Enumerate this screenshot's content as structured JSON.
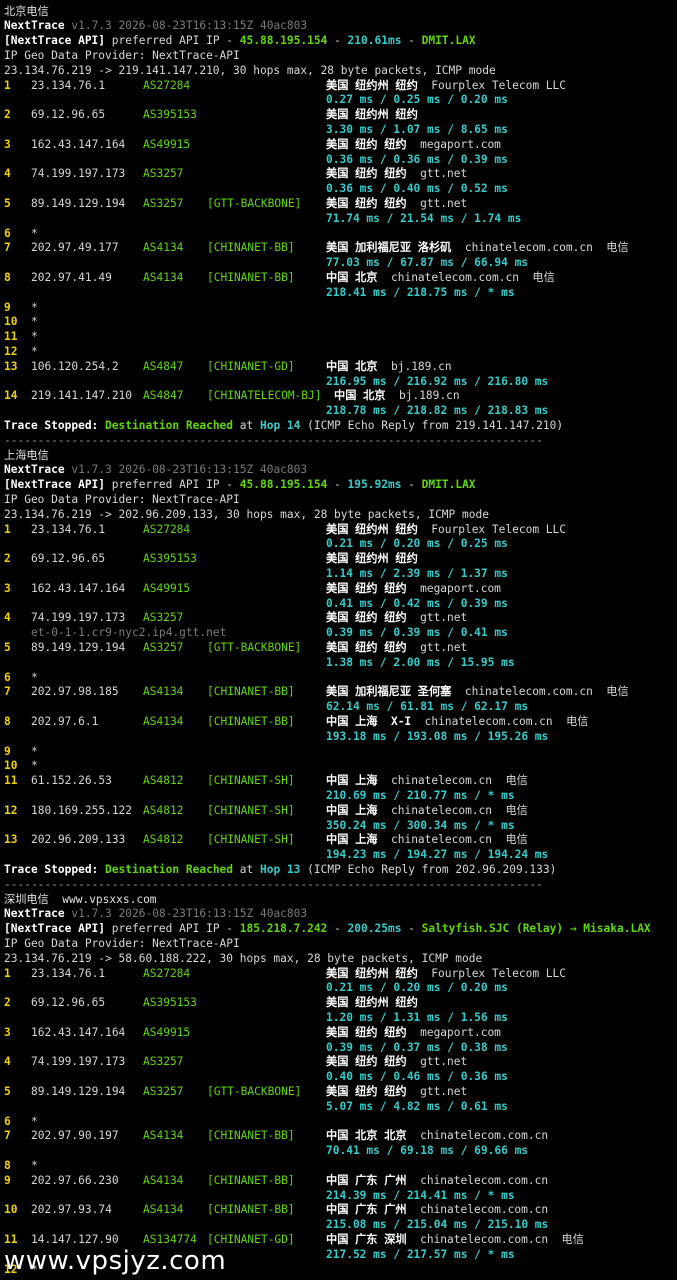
{
  "sections": [
    {
      "title": "北京电信",
      "watermark": "",
      "version_line": "v1.7.3 2026-08-23T16:13:15Z 40ac803",
      "api_ip": "45.88.195.154",
      "api_rtt": "210.61ms",
      "api_node": "DMIT.LAX",
      "provider": "IP Geo Data Provider: NextTrace-API",
      "route_line": "23.134.76.219 -> 219.141.147.210, 30 hops max, 28 byte packets, ICMP mode",
      "hops": [
        {
          "n": "1",
          "ip": "23.134.76.1",
          "as": "AS27284",
          "tag": "",
          "geo": "美国 纽约州 纽约",
          "org": "Fourplex Telecom LLC",
          "rtt": "0.27 ms / 0.25 ms / 0.20 ms"
        },
        {
          "n": "2",
          "ip": "69.12.96.65",
          "as": "AS395153",
          "tag": "",
          "geo": "美国 纽约州 纽约",
          "org": "",
          "rtt": "3.30 ms / 1.07 ms / 8.65 ms"
        },
        {
          "n": "3",
          "ip": "162.43.147.164",
          "as": "AS49915",
          "tag": "",
          "geo": "美国 纽约 纽约",
          "org": "megaport.com",
          "rtt": "0.36 ms / 0.36 ms / 0.39 ms"
        },
        {
          "n": "4",
          "ip": "74.199.197.173",
          "as": "AS3257",
          "tag": "",
          "geo": "美国 纽约 纽约",
          "org": "gtt.net",
          "rtt": "0.36 ms / 0.40 ms / 0.52 ms"
        },
        {
          "n": "5",
          "ip": "89.149.129.194",
          "as": "AS3257",
          "tag": "[GTT-BACKBONE]",
          "geo": "美国 纽约 纽约",
          "org": "gtt.net",
          "rtt": "71.74 ms / 21.54 ms / 1.74 ms"
        },
        {
          "n": "6",
          "ip": "*",
          "as": "",
          "tag": "",
          "geo": "",
          "org": "",
          "rtt": ""
        },
        {
          "n": "7",
          "ip": "202.97.49.177",
          "as": "AS4134",
          "tag": "[CHINANET-BB]",
          "geo": "美国 加利福尼亚 洛杉矶",
          "org": "chinatelecom.com.cn  电信",
          "rtt": "77.03 ms / 67.87 ms / 66.94 ms"
        },
        {
          "n": "8",
          "ip": "202.97.41.49",
          "as": "AS4134",
          "tag": "[CHINANET-BB]",
          "geo": "中国 北京",
          "org": "chinatelecom.com.cn  电信",
          "rtt": "218.41 ms / 218.75 ms / * ms"
        },
        {
          "n": "9",
          "ip": "*",
          "as": "",
          "tag": "",
          "geo": "",
          "org": "",
          "rtt": ""
        },
        {
          "n": "10",
          "ip": "*",
          "as": "",
          "tag": "",
          "geo": "",
          "org": "",
          "rtt": ""
        },
        {
          "n": "11",
          "ip": "*",
          "as": "",
          "tag": "",
          "geo": "",
          "org": "",
          "rtt": ""
        },
        {
          "n": "12",
          "ip": "*",
          "as": "",
          "tag": "",
          "geo": "",
          "org": "",
          "rtt": ""
        },
        {
          "n": "13",
          "ip": "106.120.254.2",
          "as": "AS4847",
          "tag": "[CHINANET-GD]",
          "geo": "中国 北京",
          "org": "bj.189.cn",
          "rtt": "216.95 ms / 216.92 ms / 216.80 ms"
        },
        {
          "n": "14",
          "ip": "219.141.147.210",
          "as": "AS4847",
          "tag": "[CHINATELECOM-BJ]",
          "geo": "中国 北京",
          "org": "bj.189.cn",
          "rtt": "218.78 ms / 218.82 ms / 218.83 ms"
        }
      ],
      "stop": {
        "hop": "Hop 14",
        "tail": "(ICMP Echo Reply from 219.141.147.210)"
      }
    },
    {
      "title": "上海电信",
      "watermark": "",
      "version_line": "v1.7.3 2026-08-23T16:13:15Z 40ac803",
      "api_ip": "45.88.195.154",
      "api_rtt": "195.92ms",
      "api_node": "DMIT.LAX",
      "provider": "IP Geo Data Provider: NextTrace-API",
      "route_line": "23.134.76.219 -> 202.96.209.133, 30 hops max, 28 byte packets, ICMP mode",
      "hops": [
        {
          "n": "1",
          "ip": "23.134.76.1",
          "as": "AS27284",
          "tag": "",
          "geo": "美国 纽约州 纽约",
          "org": "Fourplex Telecom LLC",
          "rtt": "0.21 ms / 0.20 ms / 0.25 ms"
        },
        {
          "n": "2",
          "ip": "69.12.96.65",
          "as": "AS395153",
          "tag": "",
          "geo": "美国 纽约州 纽约",
          "org": "",
          "rtt": "1.14 ms / 2.39 ms / 1.37 ms"
        },
        {
          "n": "3",
          "ip": "162.43.147.164",
          "as": "AS49915",
          "tag": "",
          "geo": "美国 纽约 纽约",
          "org": "megaport.com",
          "rtt": "0.41 ms / 0.42 ms / 0.39 ms"
        },
        {
          "n": "4",
          "ip": "74.199.197.173",
          "as": "AS3257",
          "tag": "",
          "geo": "美国 纽约 纽约",
          "org": "gtt.net",
          "rtt": "0.39 ms / 0.39 ms / 0.41 ms",
          "rdns": "et-0-1-1.cr9-nyc2.ip4.gtt.net"
        },
        {
          "n": "5",
          "ip": "89.149.129.194",
          "as": "AS3257",
          "tag": "[GTT-BACKBONE]",
          "geo": "美国 纽约 纽约",
          "org": "gtt.net",
          "rtt": "1.38 ms / 2.00 ms / 15.95 ms"
        },
        {
          "n": "6",
          "ip": "*",
          "as": "",
          "tag": "",
          "geo": "",
          "org": "",
          "rtt": ""
        },
        {
          "n": "7",
          "ip": "202.97.98.185",
          "as": "AS4134",
          "tag": "[CHINANET-BB]",
          "geo": "美国 加利福尼亚 圣何塞",
          "org": "chinatelecom.com.cn  电信",
          "rtt": "62.14 ms / 61.81 ms / 62.17 ms"
        },
        {
          "n": "8",
          "ip": "202.97.6.1",
          "as": "AS4134",
          "tag": "[CHINANET-BB]",
          "geo": "中国 上海  X-I",
          "org": "chinatelecom.com.cn  电信",
          "rtt": "193.18 ms / 193.08 ms / 195.26 ms"
        },
        {
          "n": "9",
          "ip": "*",
          "as": "",
          "tag": "",
          "geo": "",
          "org": "",
          "rtt": ""
        },
        {
          "n": "10",
          "ip": "*",
          "as": "",
          "tag": "",
          "geo": "",
          "org": "",
          "rtt": ""
        },
        {
          "n": "11",
          "ip": "61.152.26.53",
          "as": "AS4812",
          "tag": "[CHINANET-SH]",
          "geo": "中国 上海",
          "org": "chinatelecom.cn  电信",
          "rtt": "210.69 ms / 210.77 ms / * ms"
        },
        {
          "n": "12",
          "ip": "180.169.255.122",
          "as": "AS4812",
          "tag": "[CHINANET-SH]",
          "geo": "中国 上海",
          "org": "chinatelecom.cn  电信",
          "rtt": "350.24 ms / 300.34 ms / * ms"
        },
        {
          "n": "13",
          "ip": "202.96.209.133",
          "as": "AS4812",
          "tag": "[CHINANET-SH]",
          "geo": "中国 上海",
          "org": "chinatelecom.cn  电信",
          "rtt": "194.23 ms / 194.27 ms / 194.24 ms"
        }
      ],
      "stop": {
        "hop": "Hop 13",
        "tail": "(ICMP Echo Reply from 202.96.209.133)"
      }
    },
    {
      "title": "深圳电信",
      "watermark": "www.vpsxxs.com",
      "version_line": "v1.7.3 2026-08-23T16:13:15Z 40ac803",
      "api_ip": "185.218.7.242",
      "api_rtt": "200.25ms",
      "api_node": "Saltyfish.SJC (Relay) → Misaka.LAX",
      "provider": "IP Geo Data Provider: NextTrace-API",
      "route_line": "23.134.76.219 -> 58.60.188.222, 30 hops max, 28 byte packets, ICMP mode",
      "hops": [
        {
          "n": "1",
          "ip": "23.134.76.1",
          "as": "AS27284",
          "tag": "",
          "geo": "美国 纽约州 纽约",
          "org": "Fourplex Telecom LLC",
          "rtt": "0.21 ms / 0.20 ms / 0.20 ms"
        },
        {
          "n": "2",
          "ip": "69.12.96.65",
          "as": "AS395153",
          "tag": "",
          "geo": "美国 纽约州 纽约",
          "org": "",
          "rtt": "1.20 ms / 1.31 ms / 1.56 ms"
        },
        {
          "n": "3",
          "ip": "162.43.147.164",
          "as": "AS49915",
          "tag": "",
          "geo": "美国 纽约 纽约",
          "org": "megaport.com",
          "rtt": "0.39 ms / 0.37 ms / 0.38 ms"
        },
        {
          "n": "4",
          "ip": "74.199.197.173",
          "as": "AS3257",
          "tag": "",
          "geo": "美国 纽约 纽约",
          "org": "gtt.net",
          "rtt": "0.40 ms / 0.46 ms / 0.36 ms"
        },
        {
          "n": "5",
          "ip": "89.149.129.194",
          "as": "AS3257",
          "tag": "[GTT-BACKBONE]",
          "geo": "美国 纽约 纽约",
          "org": "gtt.net",
          "rtt": "5.07 ms / 4.82 ms / 0.61 ms"
        },
        {
          "n": "6",
          "ip": "*",
          "as": "",
          "tag": "",
          "geo": "",
          "org": "",
          "rtt": ""
        },
        {
          "n": "7",
          "ip": "202.97.90.197",
          "as": "AS4134",
          "tag": "[CHINANET-BB]",
          "geo": "中国 北京 北京",
          "org": "chinatelecom.com.cn",
          "rtt": "70.41 ms / 69.18 ms / 69.66 ms"
        },
        {
          "n": "8",
          "ip": "*",
          "as": "",
          "tag": "",
          "geo": "",
          "org": "",
          "rtt": ""
        },
        {
          "n": "9",
          "ip": "202.97.66.230",
          "as": "AS4134",
          "tag": "[CHINANET-BB]",
          "geo": "中国 广东 广州",
          "org": "chinatelecom.com.cn",
          "rtt": "214.39 ms / 214.41 ms / * ms"
        },
        {
          "n": "10",
          "ip": "202.97.93.74",
          "as": "AS4134",
          "tag": "[CHINANET-BB]",
          "geo": "中国 广东 广州",
          "org": "chinatelecom.com.cn",
          "rtt": "215.08 ms / 215.04 ms / 215.10 ms"
        },
        {
          "n": "11",
          "ip": "14.147.127.90",
          "as": "AS134774",
          "tag": "[CHINANET-GD]",
          "geo": "中国 广东 深圳",
          "org": "chinatelecom.com.cn  电信",
          "rtt": "217.52 ms / 217.57 ms / * ms"
        },
        {
          "n": "12",
          "ip": "*",
          "as": "",
          "tag": "",
          "geo": "",
          "org": "",
          "rtt": ""
        }
      ],
      "stop": null
    }
  ],
  "labels": {
    "brand": "NextTrace",
    "api_prefix": "[NextTrace API]",
    "api_mid": " preferred API IP - ",
    "dash": " - ",
    "stopped": "Trace Stopped:",
    "reached": "Destination Reached",
    "at": " at "
  },
  "separator": "--------------------------------------------------------------------------------",
  "bottom_watermark": "www.vpsjyz.com",
  "colors": {
    "background": "#000000",
    "hop_number": "#f0d000",
    "asn": "#5fd700",
    "latency": "#33cccc",
    "text": "#d6d6d6"
  }
}
